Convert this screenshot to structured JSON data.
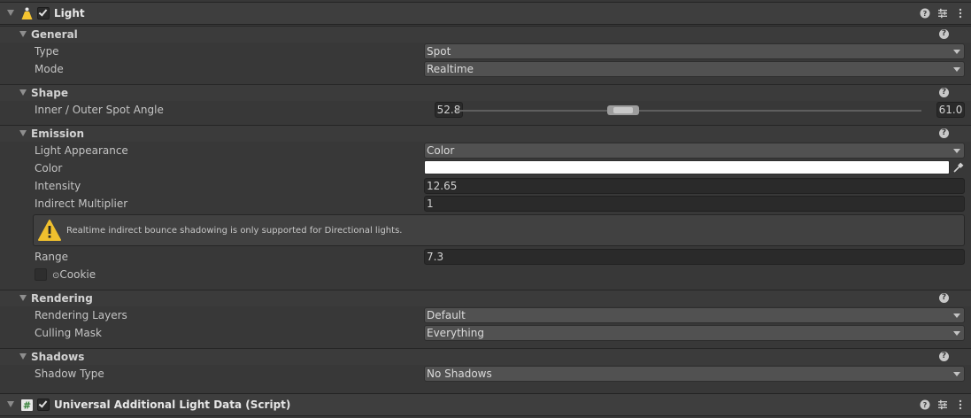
{
  "light_component": {
    "title": "Light",
    "enabled": true,
    "sections": {
      "general": {
        "title": "General"
      },
      "shape": {
        "title": "Shape"
      },
      "emission": {
        "title": "Emission"
      },
      "rendering": {
        "title": "Rendering"
      },
      "shadows": {
        "title": "Shadows"
      }
    },
    "general": {
      "type_label": "Type",
      "type_value": "Spot",
      "mode_label": "Mode",
      "mode_value": "Realtime"
    },
    "shape": {
      "spot_angle_label": "Inner / Outer Spot Angle",
      "inner_angle": "52.8",
      "outer_angle": "61.0"
    },
    "emission": {
      "appearance_label": "Light Appearance",
      "appearance_value": "Color",
      "color_label": "Color",
      "color_value": "#ffffff",
      "intensity_label": "Intensity",
      "intensity_value": "12.65",
      "indirect_label": "Indirect Multiplier",
      "indirect_value": "1",
      "warning": "Realtime indirect bounce shadowing is only supported for Directional lights.",
      "range_label": "Range",
      "range_value": "7.3",
      "cookie_prefix": "⊙",
      "cookie_label": "Cookie"
    },
    "rendering": {
      "layers_label": "Rendering Layers",
      "layers_value": "Default",
      "culling_label": "Culling Mask",
      "culling_value": "Everything"
    },
    "shadows": {
      "shadow_type_label": "Shadow Type",
      "shadow_type_value": "No Shadows"
    },
    "help_glyph": "?"
  },
  "urp_component": {
    "title": "Universal Additional Light Data (Script)",
    "enabled": true
  },
  "icons": {
    "light_icon": "light-cone-icon",
    "script_icon": "script-hash-icon",
    "help": "help-icon",
    "presets": "presets-sliders-icon",
    "menu": "kebab-menu-icon",
    "picker": "eyedropper-icon",
    "warning": "warning-triangle-icon"
  },
  "colors": {
    "accent_warning": "#f0c02e",
    "light_icon": "#f4c430"
  }
}
